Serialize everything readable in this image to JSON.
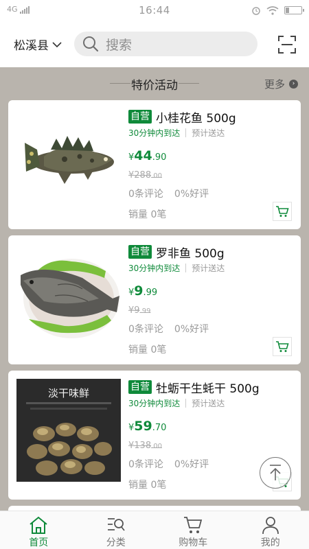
{
  "status_bar": {
    "network": "4G",
    "time": "16:44"
  },
  "header": {
    "location": "松溪县",
    "search_placeholder": "搜索"
  },
  "section": {
    "title": "特价活动",
    "more": "更多"
  },
  "products": [
    {
      "tag": "自营",
      "name": "小桂花鱼  500g",
      "delivery": "30分钟内到达",
      "estimate": "预计送达",
      "currency": "¥",
      "price_int": "44",
      "price_dec": ".90",
      "orig_int": "¥288",
      "orig_dec": ".00",
      "reviews": "0条评论",
      "rating": "0%好评",
      "sales": "销量 0笔"
    },
    {
      "tag": "自营",
      "name": "罗非鱼  500g",
      "delivery": "30分钟内到达",
      "estimate": "预计送达",
      "currency": "¥",
      "price_int": "9",
      "price_dec": ".99",
      "orig_int": "¥9",
      "orig_dec": ".99",
      "reviews": "0条评论",
      "rating": "0%好评",
      "sales": "销量 0笔"
    },
    {
      "tag": "自营",
      "name": "牡蛎干生蚝干  500g",
      "delivery": "30分钟内到达",
      "estimate": "预计送达",
      "currency": "¥",
      "price_int": "59",
      "price_dec": ".70",
      "orig_int": "¥138",
      "orig_dec": ".00",
      "reviews": "0条评论",
      "rating": "0%好评",
      "sales": "销量 0笔",
      "image_title": "淡干味鲜"
    }
  ],
  "tabbar": [
    {
      "label": "首页",
      "active": true
    },
    {
      "label": "分类"
    },
    {
      "label": "购物车"
    },
    {
      "label": "我的"
    }
  ],
  "colors": {
    "brand": "#0f8a3a",
    "backdrop": "#b9b4ad"
  }
}
